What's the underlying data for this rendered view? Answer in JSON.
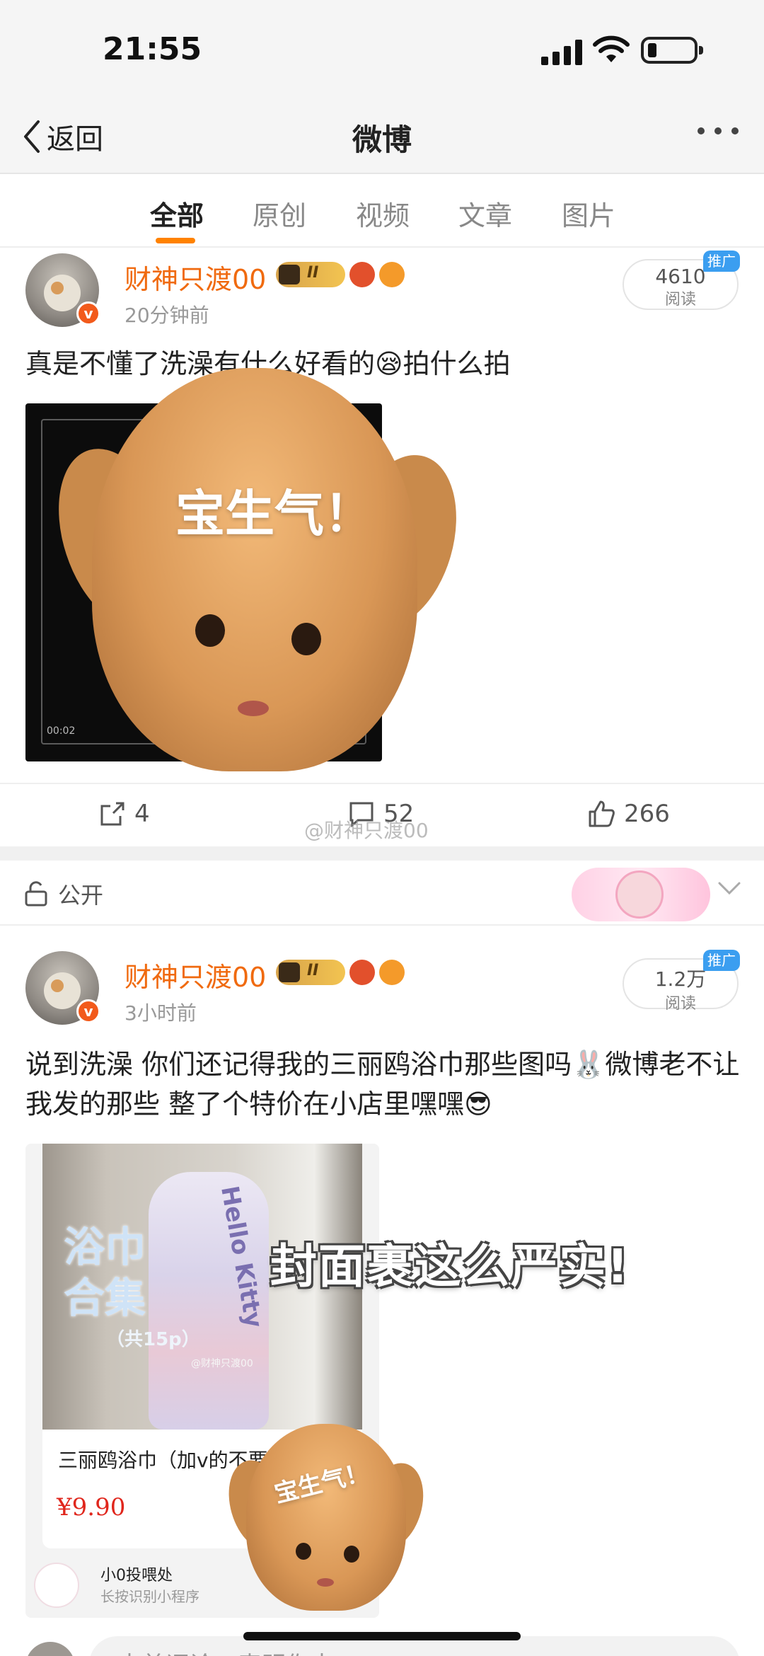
{
  "status": {
    "time": "21:55"
  },
  "nav": {
    "back_label": "返回",
    "title": "微博"
  },
  "tabs": [
    {
      "label": "全部",
      "active": true
    },
    {
      "label": "原创",
      "active": false
    },
    {
      "label": "视频",
      "active": false
    },
    {
      "label": "文章",
      "active": false
    },
    {
      "label": "图片",
      "active": false
    }
  ],
  "colors": {
    "accent": "#ff8200",
    "username": "#f06a0f",
    "ad_badge": "#3b9ef0",
    "price": "#e0261c"
  },
  "post1": {
    "username": "财神只渡00",
    "level": "II",
    "time": "20分钟前",
    "reads_value": "4610",
    "reads_label": "阅读",
    "ad_label": "推广",
    "text": "真是不懂了洗澡有什么好看的😪拍什么拍",
    "sticker_caption": "宝生气！",
    "video_time": "00:02",
    "repost_count": "4",
    "comment_count": "52",
    "like_count": "266",
    "watermark": "@财神只渡00"
  },
  "visibility": {
    "label": "公开"
  },
  "post2": {
    "username": "财神只渡00",
    "level": "II",
    "time": "3小时前",
    "reads_value": "1.2万",
    "reads_label": "阅读",
    "ad_label": "推广",
    "text": "说到洗澡 你们还记得我的三丽鸥浴巾那些图吗🐰微博老不让我发的那些 整了个特价在小店里嘿嘿😎",
    "overlay_caption": "封面裹这么严实!",
    "product": {
      "image_title_line1": "浴巾",
      "image_title_line2": "合集",
      "image_subtitle": "（共15p）",
      "image_watermark": "@财神只渡00",
      "towel_print": "Hello Kitty",
      "name": "三丽鸥浴巾（加v的不要",
      "price": "¥9.90",
      "mini_program_name": "小0投喂处",
      "mini_program_sub": "长按识别小程序"
    },
    "sticker_caption": "宝生气！"
  },
  "comment_placeholder": "来首评论，表明你来"
}
